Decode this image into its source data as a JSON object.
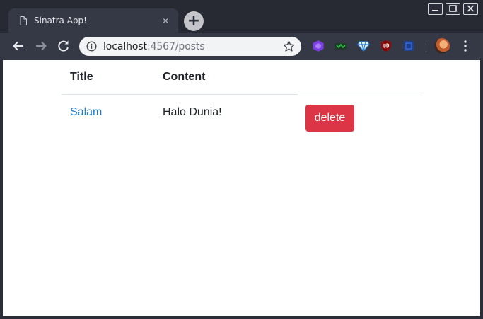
{
  "browser": {
    "tab_title": "Sinatra App!",
    "tab_close": "×",
    "new_tab": "+",
    "url_host": "localhost",
    "url_path": ":4567/posts"
  },
  "page": {
    "table": {
      "headers": [
        "Title",
        "Content"
      ],
      "rows": [
        {
          "title": "Salam",
          "content": "Halo Dunia!",
          "action": "delete"
        }
      ]
    }
  },
  "colors": {
    "link": "#1a7fd6",
    "danger": "#dc3545",
    "chrome_dark": "#272a33",
    "chrome_tab": "#353946"
  }
}
